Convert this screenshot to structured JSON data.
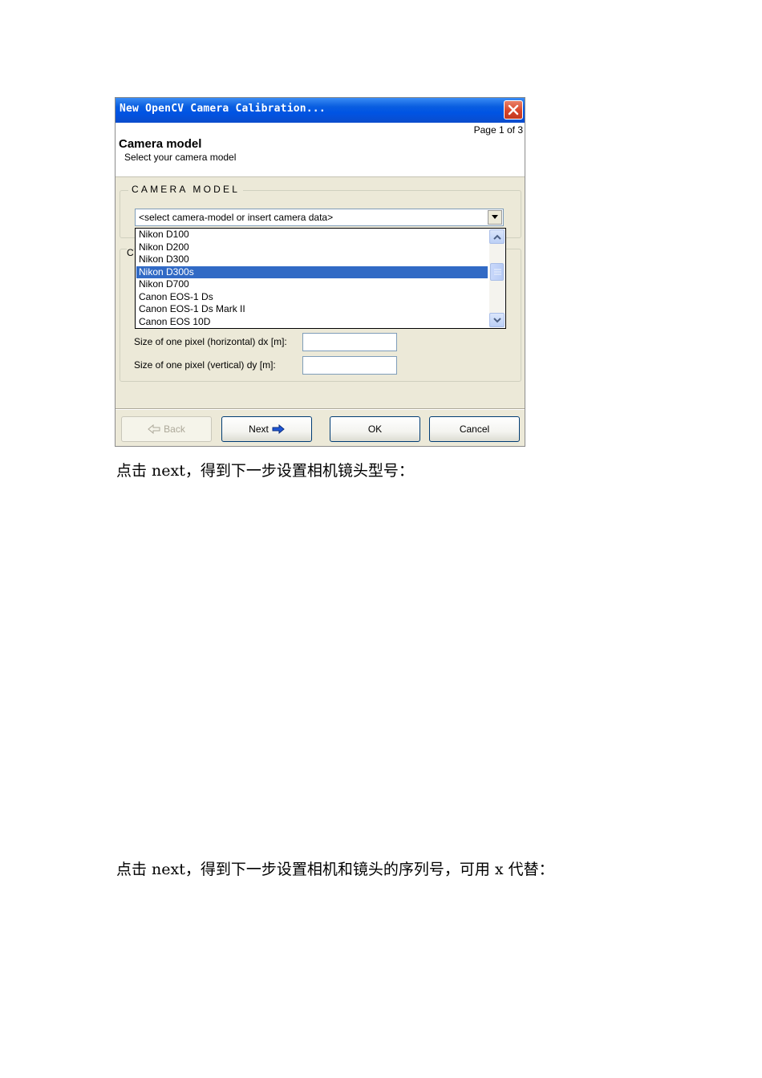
{
  "dialog": {
    "title": "New OpenCV Camera Calibration...",
    "page_indicator": "Page 1 of 3",
    "header": {
      "title": "Camera model",
      "subtitle": "Select your camera model"
    },
    "camera_model_group": {
      "label": "CAMERA MODEL",
      "combo_value": "<select camera-model or insert camera data>",
      "dropdown_items": [
        "Nikon D100",
        "Nikon D200",
        "Nikon D300",
        "Nikon D300s",
        "Nikon D700",
        "Canon EOS-1 Ds",
        "Canon EOS-1 Ds Mark II",
        "Canon EOS 10D"
      ],
      "selected_item": "Nikon D300s"
    },
    "camera_data_group": {
      "label": "C",
      "pixel_horizontal_label": "Size of one pixel (horizontal) dx [m]:",
      "pixel_horizontal_value": "",
      "pixel_vertical_label": "Size of one pixel (vertical) dy [m]:",
      "pixel_vertical_value": ""
    },
    "buttons": {
      "back": "Back",
      "next": "Next",
      "ok": "OK",
      "cancel": "Cancel"
    }
  },
  "captions": {
    "first": "点击 next，得到下一步设置相机镜头型号：",
    "second": "点击 next，得到下一步设置相机和镜头的序列号，可用 x 代替："
  },
  "colors": {
    "titlebar": "#0054e3",
    "selection": "#316ac5",
    "dialog_bg": "#ece9d8",
    "close_button": "#d8452a"
  }
}
